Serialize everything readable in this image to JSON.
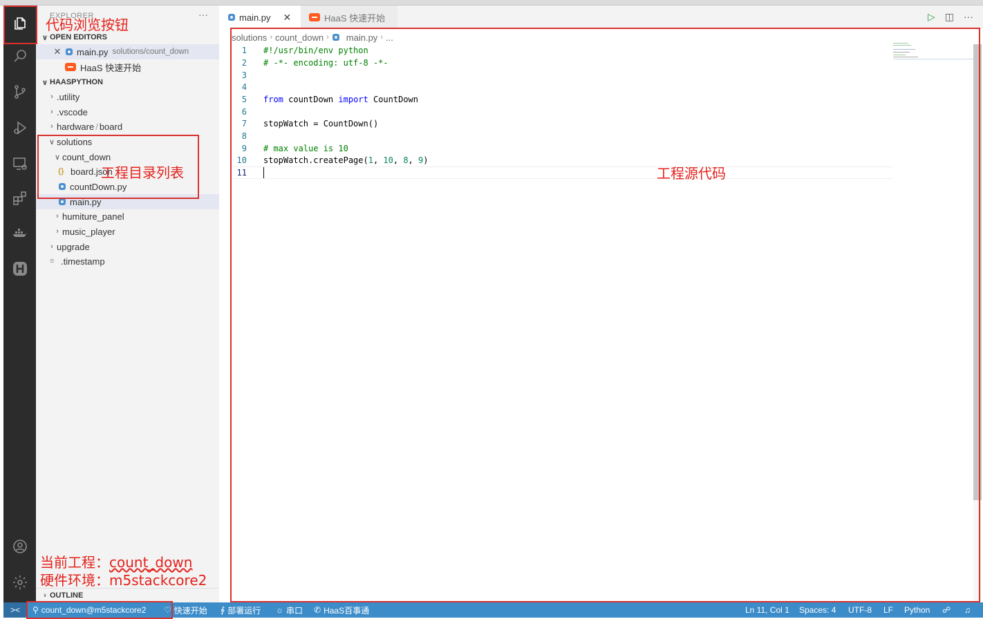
{
  "sidebar": {
    "header": "EXPLORER",
    "more": "···",
    "open_editors": {
      "label": "OPEN EDITORS",
      "items": [
        {
          "name": "main.py",
          "path": "solutions/count_down"
        },
        {
          "name": "HaaS 快速开始"
        }
      ]
    },
    "project": {
      "label": "HAASPYTHON",
      "tree": [
        {
          "label": ".utility"
        },
        {
          "label": ".vscode"
        },
        {
          "label": "hardware",
          "sep": "/",
          "label2": "board"
        },
        {
          "label": "solutions"
        },
        {
          "label": "count_down"
        },
        {
          "label": "board.json"
        },
        {
          "label": "countDown.py"
        },
        {
          "label": "main.py"
        },
        {
          "label": "humiture_panel"
        },
        {
          "label": "music_player"
        },
        {
          "label": "upgrade"
        },
        {
          "label": ".timestamp"
        }
      ]
    },
    "outline": "OUTLINE"
  },
  "tabs": [
    {
      "label": "main.py",
      "close": "✕"
    },
    {
      "label": "HaaS 快速开始"
    }
  ],
  "breadcrumb": [
    "solutions",
    "count_down",
    "main.py",
    "..."
  ],
  "editor": {
    "lines": [
      {
        "n": "1",
        "text": "#!/usr/bin/env python"
      },
      {
        "n": "2",
        "text": "# -*- encoding: utf-8 -*-"
      },
      {
        "n": "3",
        "text": ""
      },
      {
        "n": "4",
        "text": ""
      },
      {
        "n": "5",
        "kw1": "from",
        "mid": " countDown ",
        "kw2": "import",
        "end": " CountDown"
      },
      {
        "n": "6",
        "text": ""
      },
      {
        "n": "7",
        "text": "stopWatch = CountDown()"
      },
      {
        "n": "8",
        "text": ""
      },
      {
        "n": "9",
        "text": "# max value is 10"
      },
      {
        "n": "10",
        "pre": "stopWatch.createPage(",
        "a": "1",
        "b": "10",
        "c": "8",
        "d": "9",
        "post": ")"
      },
      {
        "n": "11",
        "text": ""
      }
    ]
  },
  "statusbar": {
    "remote": "><",
    "project": "count_down@m5stackcore2",
    "quickstart": "快速开始",
    "deploy": "部署运行",
    "serial": "串口",
    "haas": "HaaS百事通",
    "position": "Ln 11, Col 1",
    "spaces": "Spaces: 4",
    "encoding": "UTF-8",
    "eol": "LF",
    "language": "Python"
  },
  "annotations": {
    "explorer_button": "代码浏览按钮",
    "project_tree": "工程目录列表",
    "source_code": "工程源代码",
    "current_project_prefix": "当前工程：",
    "current_project": "count_down",
    "hardware_prefix": "硬件环境：",
    "hardware": "m5stackcore2"
  },
  "colors": {
    "activity_bar": "#2c2c2c",
    "status_bar": "#3c8cc9",
    "annotation": "#e4211b",
    "haas_orange": "#ff5a1f"
  }
}
